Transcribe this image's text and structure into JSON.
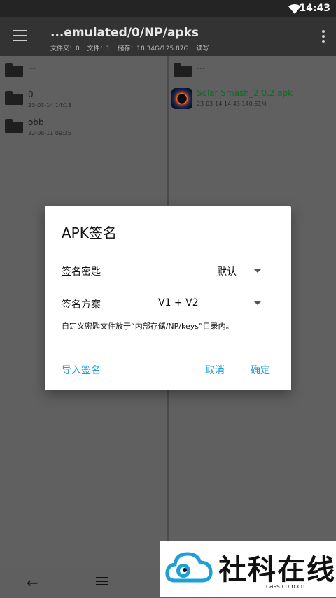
{
  "status_bar": {
    "time": "14:43",
    "wifi_icon": "wifi-icon"
  },
  "app_bar": {
    "path": "...emulated/0/NP/apks",
    "stats": {
      "folders": "文件夹：0",
      "files": "文件：1",
      "storage": "储存：18.34G/125.87G",
      "mode": "读写"
    }
  },
  "left_pane": {
    "entries": [
      {
        "name": "...",
        "meta": ""
      },
      {
        "name": "0",
        "meta": "23-03-14 14:13"
      },
      {
        "name": "obb",
        "meta": "22-08-11 09:35"
      }
    ]
  },
  "right_pane": {
    "parent": {
      "name": "..."
    },
    "apk": {
      "name": "Solar Smash_2.0.2.apk",
      "meta": "23-03-14 14:43  140.61M"
    }
  },
  "dialog": {
    "title": "APK签名",
    "key_label": "签名密匙",
    "key_value": "默认",
    "scheme_label": "签名方案",
    "scheme_value": "V1 + V2",
    "hint": "自定义密匙文件放于“内部存储/NP/keys”目录内。",
    "import_button": "导入签名",
    "cancel_button": "取消",
    "confirm_button": "确定"
  },
  "watermark": {
    "brand": "社科在线",
    "url": "cass.com.cn"
  },
  "colors": {
    "accent": "#1e9fd6",
    "apk_name": "#0f6b20"
  }
}
